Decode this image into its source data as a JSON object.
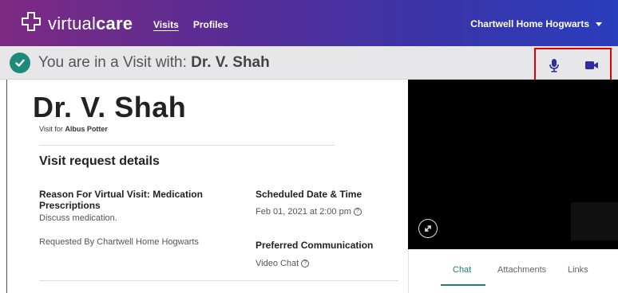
{
  "brand": {
    "name_light": "virtual",
    "name_bold": "care"
  },
  "nav": {
    "visits": "Visits",
    "profiles": "Profiles"
  },
  "account": {
    "name": "Chartwell Home Hogwarts"
  },
  "banner": {
    "prefix": "You are in a Visit with: ",
    "doctor": "Dr. V. Shah"
  },
  "visit": {
    "doctor_name": "Dr. V. Shah",
    "visit_for_prefix": "Visit for ",
    "patient": "Albus Potter",
    "section_title": "Visit request details",
    "reason_label": "Reason For Virtual Visit: Medication Prescriptions",
    "reason_value": "Discuss medication.",
    "requested_by": "Requested By Chartwell Home Hogwarts",
    "scheduled_label": "Scheduled Date & Time",
    "scheduled_value": "Feb 01, 2021 at  2:00 pm",
    "preferred_label": "Preferred Communication",
    "preferred_value": "Video Chat"
  },
  "tabs": {
    "chat": "Chat",
    "attachments": "Attachments",
    "links": "Links"
  },
  "icons": {
    "logo": "cross-logo-icon",
    "check": "check-circle-icon",
    "mic": "microphone-icon",
    "camera": "video-camera-icon",
    "expand": "expand-icon",
    "help": "help-circle-icon"
  },
  "colors": {
    "accent": "#1a7f79",
    "check": "#1f8a79",
    "media_icon": "#2d2fa0",
    "highlight_box": "#e00000",
    "nav_gradient_start": "#7d2a82",
    "nav_gradient_end": "#2a3dbc"
  }
}
